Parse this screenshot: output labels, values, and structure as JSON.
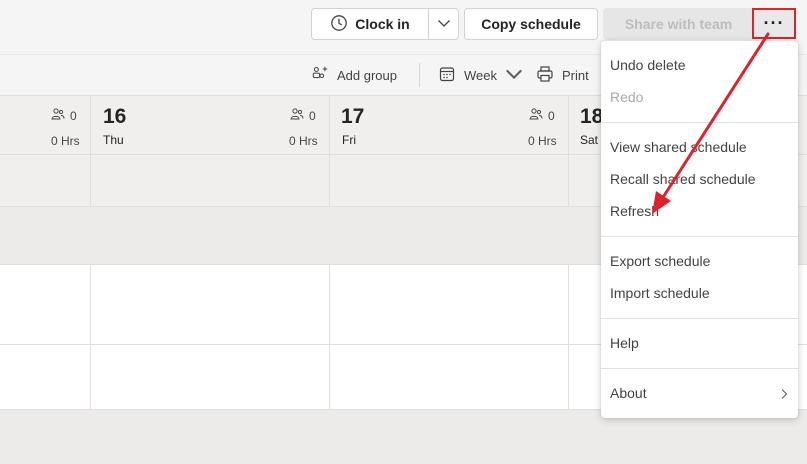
{
  "toolbar": {
    "clock_in_label": "Clock in",
    "copy_schedule_label": "Copy schedule",
    "share_with_team_label": "Share with team",
    "more_options_label": "···"
  },
  "secondary_toolbar": {
    "add_group_label": "Add group",
    "view_label": "Week",
    "print_label": "Print"
  },
  "days": [
    {
      "num": "",
      "name": "",
      "count": "0",
      "hours": "0 Hrs"
    },
    {
      "num": "16",
      "name": "Thu",
      "count": "0",
      "hours": "0 Hrs"
    },
    {
      "num": "17",
      "name": "Fri",
      "count": "0",
      "hours": "0 Hrs"
    },
    {
      "num": "18",
      "name": "Sat",
      "count": "",
      "hours": ""
    }
  ],
  "menu": {
    "items": [
      {
        "label": "Undo delete",
        "enabled": true
      },
      {
        "label": "Redo",
        "enabled": false
      },
      {
        "label": "View shared schedule",
        "enabled": true
      },
      {
        "label": "Recall shared schedule",
        "enabled": true
      },
      {
        "label": "Refresh",
        "enabled": true
      },
      {
        "label": "Export schedule",
        "enabled": true
      },
      {
        "label": "Import schedule",
        "enabled": true
      },
      {
        "label": "Help",
        "enabled": true
      },
      {
        "label": "About",
        "enabled": true
      }
    ]
  },
  "colors": {
    "annotation_red": "#e0202b",
    "disabled_text": "#a8a8a8",
    "menu_text": "#424242"
  },
  "icons": [
    "clock-icon",
    "chevron-down-icon",
    "more-options-icon",
    "add-group-icon",
    "calendar-icon",
    "printer-icon",
    "people-icon",
    "chevron-right-icon"
  ]
}
